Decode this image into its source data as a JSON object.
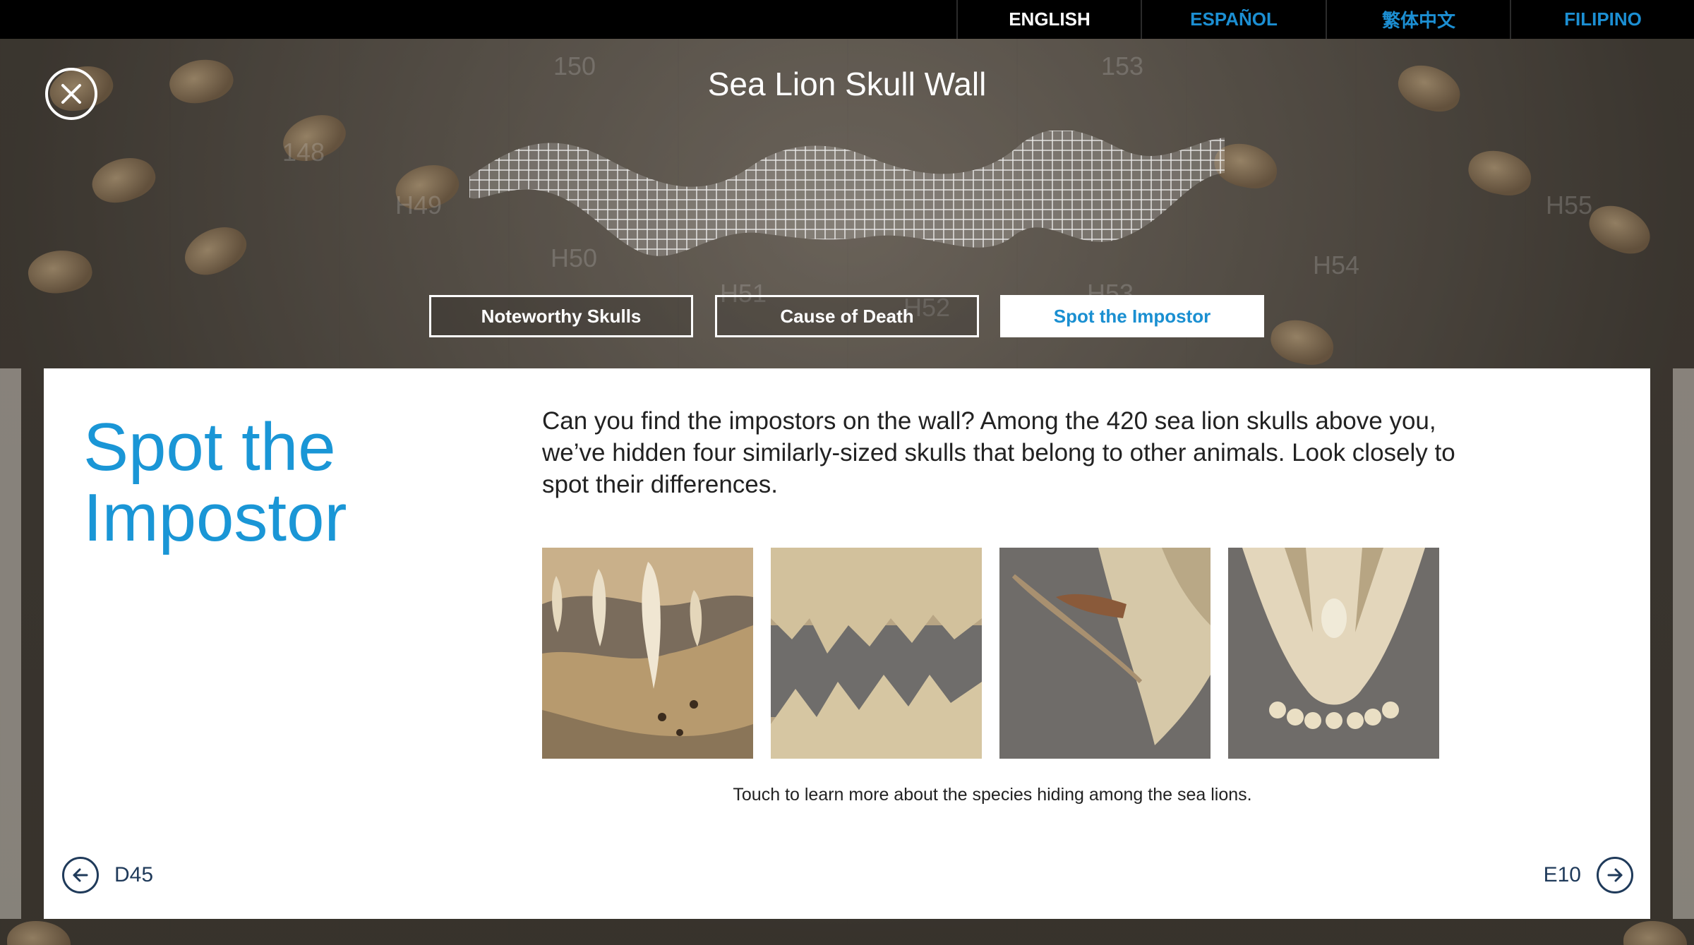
{
  "languages": [
    {
      "label": "ENGLISH",
      "active": true
    },
    {
      "label": "ESPAÑOL",
      "active": false
    },
    {
      "label": "繁体中文",
      "active": false
    },
    {
      "label": "FILIPINO",
      "active": false
    }
  ],
  "wall_labels": [
    "150",
    "153",
    "H49",
    "H50",
    "H51",
    "H52",
    "H53",
    "H54",
    "H55",
    "148"
  ],
  "page": {
    "title": "Sea Lion Skull Wall",
    "close_icon": "close-icon"
  },
  "tabs": [
    {
      "label": "Noteworthy Skulls",
      "active": false
    },
    {
      "label": "Cause of Death",
      "active": false
    },
    {
      "label": "Spot the Impostor",
      "active": true
    }
  ],
  "panel": {
    "heading_line1": "Spot the",
    "heading_line2": "Impostor",
    "intro": "Can you find the impostors on the wall? Among the 420 sea lion skulls above you, we’ve hidden four similarly-sized skulls that belong to other animals. Look closely to spot their differences.",
    "caption": "Touch to learn more about the species hiding among the sea lions.",
    "prev_label": "D45",
    "next_label": "E10"
  },
  "colors": {
    "accent_blue": "#1a96d6",
    "nav_navy": "#1f3a5a",
    "lang_blue": "#1c8fd3"
  }
}
